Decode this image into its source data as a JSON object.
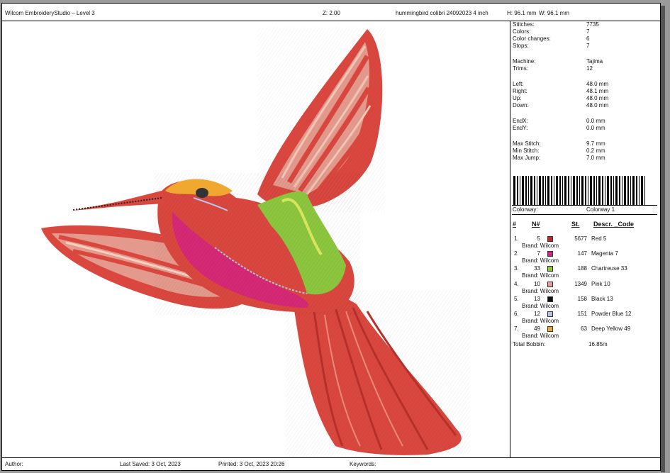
{
  "header": {
    "app_title": "Wilcom EmbroideryStudio – Level 3",
    "zoom": "Z: 2.00",
    "file_name": "hummingbird colibri 24092023 4 inch",
    "height": "H: 96.1 mm",
    "width": "W: 96.1 mm"
  },
  "stats": [
    {
      "label": "Stitches:",
      "value": "7735"
    },
    {
      "label": "Colors:",
      "value": "7"
    },
    {
      "label": "Color changes:",
      "value": "6"
    },
    {
      "label": "Stops:",
      "value": "7"
    },
    {
      "label": "Machine:",
      "value": "Tajima"
    },
    {
      "label": "Trims:",
      "value": "12"
    },
    {
      "label": "Left:",
      "value": "48.0 mm"
    },
    {
      "label": "Right:",
      "value": "48.1 mm"
    },
    {
      "label": "Up:",
      "value": "48.0 mm"
    },
    {
      "label": "Down:",
      "value": "48.0 mm"
    },
    {
      "label": "EndX:",
      "value": "0.0 mm"
    },
    {
      "label": "EndY:",
      "value": "0.0 mm"
    },
    {
      "label": "Max Stitch:",
      "value": "9.7 mm"
    },
    {
      "label": "Min Stitch:",
      "value": "0.2 mm"
    },
    {
      "label": "Max Jump:",
      "value": "7.0 mm"
    }
  ],
  "colorway": {
    "label": "Colorway:",
    "value": "Colorway 1"
  },
  "table_headers": {
    "num": "#",
    "n": "N#",
    "st": "St.",
    "desc": "Descr. _Code"
  },
  "colors": [
    {
      "idx": "1.",
      "n": "5",
      "brand": "Brand: Wilcom",
      "stitches": "5677",
      "desc": "Red 5",
      "color": "#c4262e"
    },
    {
      "idx": "2.",
      "n": "7",
      "brand": "Brand: Wilcom",
      "stitches": "147",
      "desc": "Magenta 7",
      "color": "#d4237f"
    },
    {
      "idx": "3.",
      "n": "33",
      "brand": "Brand: Wilcom",
      "stitches": "188",
      "desc": "Chartreuse 33",
      "color": "#8cc63f"
    },
    {
      "idx": "4.",
      "n": "10",
      "brand": "Brand: Wilcom",
      "stitches": "1349",
      "desc": "Pink 10",
      "color": "#ef9a9a"
    },
    {
      "idx": "5.",
      "n": "13",
      "brand": "Brand: Wilcom",
      "stitches": "158",
      "desc": "Black 13",
      "color": "#111111"
    },
    {
      "idx": "6.",
      "n": "12",
      "brand": "Brand: Wilcom",
      "stitches": "151",
      "desc": "Powder Blue 12",
      "color": "#b7c4e6"
    },
    {
      "idx": "7.",
      "n": "49",
      "brand": "Brand: Wilcom",
      "stitches": "63",
      "desc": "Deep Yellow 49",
      "color": "#f0a830"
    }
  ],
  "total_bobbin": {
    "label": "Total Bobbin:",
    "value": "16.85m"
  },
  "footer": {
    "author": "Author:",
    "last_saved": "Last Saved:  3 Oct, 2023",
    "printed": "Printed:  3 Oct, 2023 20:26",
    "keywords": "Keywords:"
  }
}
